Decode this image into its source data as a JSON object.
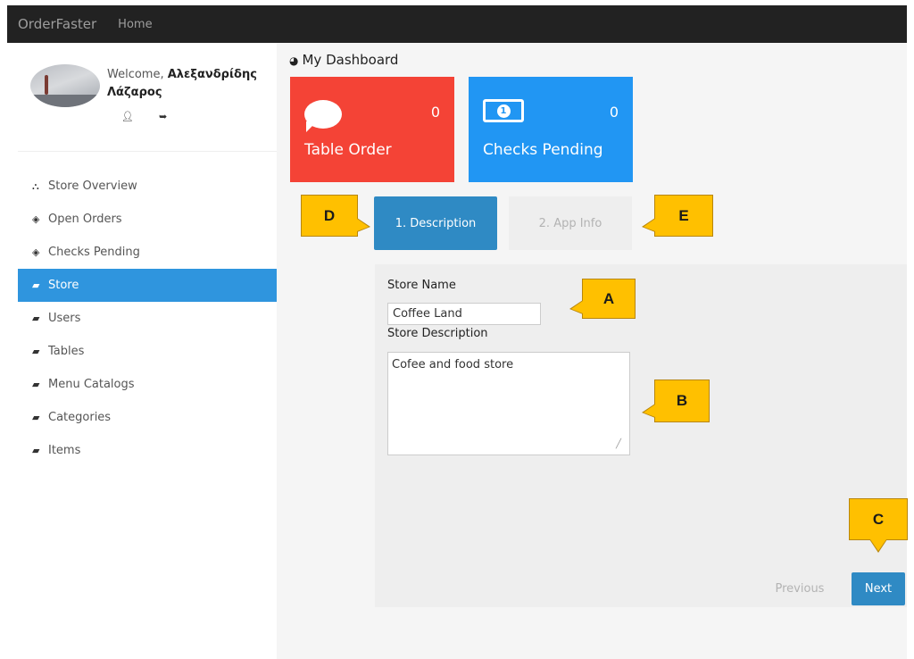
{
  "navbar": {
    "brand": "OrderFaster",
    "home_link": "Home"
  },
  "profile": {
    "welcome_prefix": "Welcome, ",
    "user_name": "Αλεξανδρίδης Λάζαρος",
    "user_icon": "user-icon",
    "logout_icon": "sign-out-icon"
  },
  "sidebar": {
    "items": [
      {
        "label": "Store Overview",
        "icon": "sitemap-icon",
        "glyph": "⛬"
      },
      {
        "label": "Open Orders",
        "icon": "diamond-icon",
        "glyph": "◈"
      },
      {
        "label": "Checks Pending",
        "icon": "diamond-icon",
        "glyph": "◈"
      },
      {
        "label": "Store",
        "icon": "book-icon",
        "glyph": "▰",
        "active": true
      },
      {
        "label": "Users",
        "icon": "book-icon",
        "glyph": "▰"
      },
      {
        "label": "Tables",
        "icon": "book-icon",
        "glyph": "▰"
      },
      {
        "label": "Menu Catalogs",
        "icon": "book-icon",
        "glyph": "▰"
      },
      {
        "label": "Categories",
        "icon": "book-icon",
        "glyph": "▰"
      },
      {
        "label": "Items",
        "icon": "book-icon",
        "glyph": "▰"
      }
    ],
    "active_color": "#2f95de"
  },
  "dashboard": {
    "title": "My Dashboard",
    "title_icon": "dashboard-icon",
    "tiles": [
      {
        "label": "Table Order",
        "count": "0",
        "icon": "comment-icon",
        "color": "#f44336"
      },
      {
        "label": "Checks Pending",
        "count": "0",
        "icon": "money-bill-icon",
        "color": "#2196f3"
      }
    ]
  },
  "wizard": {
    "steps": [
      {
        "label": "1. Description",
        "active": true
      },
      {
        "label": "2. App Info",
        "active": false
      }
    ],
    "accent_color": "#2f8ac4"
  },
  "form": {
    "store_name_label": "Store Name",
    "store_name_value": "Coffee Land",
    "store_description_label": "Store Description",
    "store_description_value": "Cofee and food store"
  },
  "buttons": {
    "previous": "Previous",
    "next": "Next"
  },
  "callouts": {
    "a": "A",
    "b": "B",
    "c": "C",
    "d": "D",
    "e": "E",
    "color": "#ffc000"
  }
}
